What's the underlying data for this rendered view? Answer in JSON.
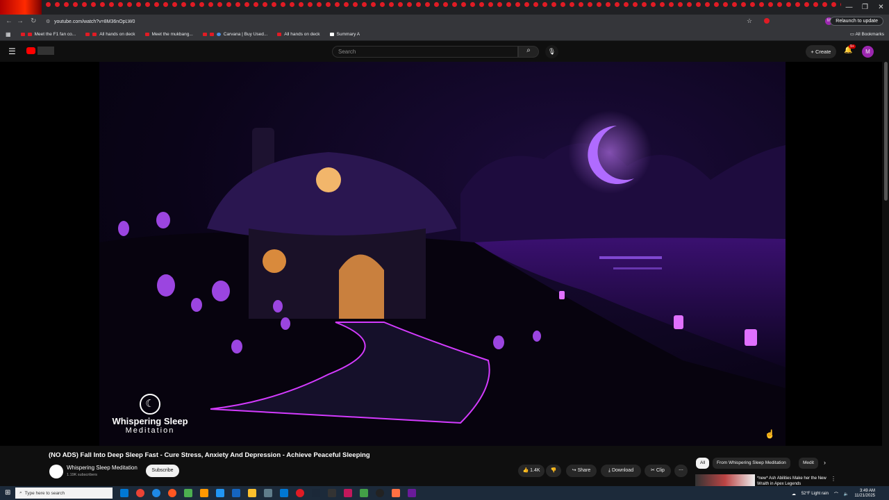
{
  "browser": {
    "url": "youtube.com/watch?v=8M36nOpLW0",
    "relaunch_label": "Relaunch to update",
    "bookmarks": [
      "Meet the F1 fan co...",
      "All hands on deck",
      "Meet the mukbang...",
      "Carvana | Buy Used...",
      "All hands on deck",
      "Summary A"
    ],
    "all_bookmarks_label": "All Bookmarks"
  },
  "youtube": {
    "search_placeholder": "Search",
    "create_label": "Create",
    "notification_count": "9+",
    "avatar_letter": "M"
  },
  "video": {
    "title": "(NO ADS) Fall Into Deep Sleep Fast - Cure Stress, Anxiety And Depression - Achieve Peaceful Sleeping",
    "watermark_line1": "Whispering Sleep",
    "watermark_line2": "Meditation"
  },
  "channel": {
    "name": "Whispering Sleep Meditation",
    "subscribers": "1.19K subscribers",
    "subscribe_label": "Subscribe"
  },
  "actions": {
    "likes": "1.4K",
    "share": "Share",
    "download": "Download",
    "clip": "Clip"
  },
  "chips": [
    "All",
    "From Whispering Sleep Meditation",
    "Medit"
  ],
  "recommendation": {
    "title": "*new* Ash Abilities Make her the New Wraith in Apex Legends"
  },
  "taskbar": {
    "search_placeholder": "Type here to search",
    "weather": "52°F Light rain",
    "time": "3:49 AM",
    "date": "11/21/2025"
  },
  "colors": {
    "accent_red": "#ff0000",
    "purple": "#a040ff",
    "avatar": "#9c27b0"
  }
}
